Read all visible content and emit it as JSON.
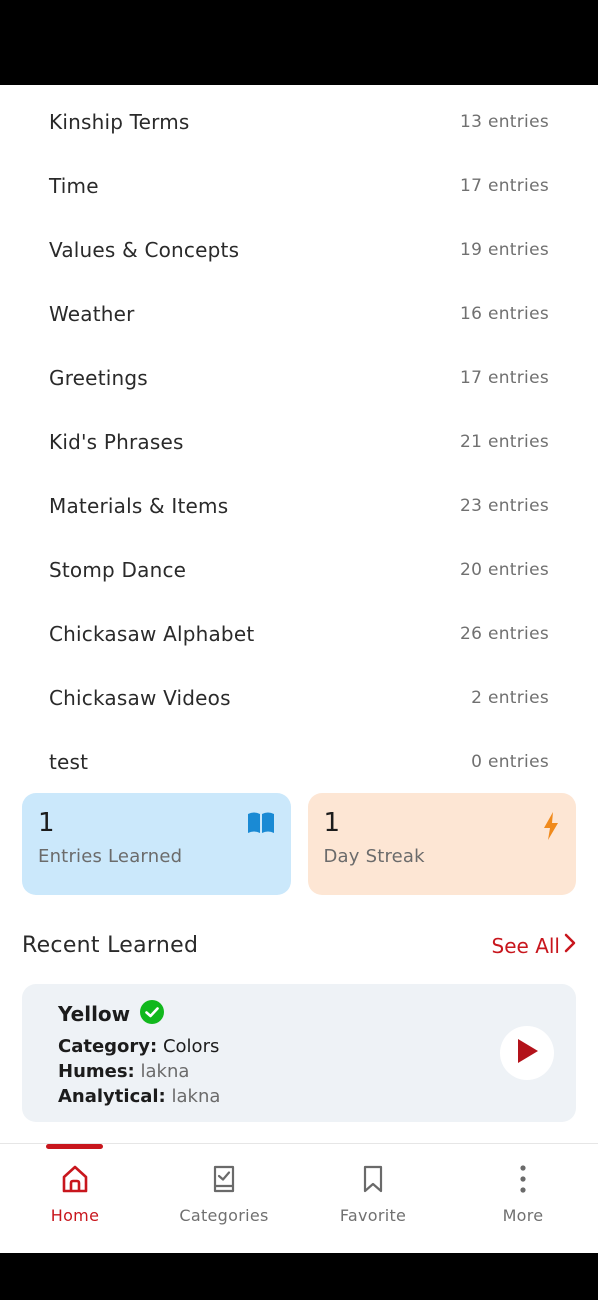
{
  "categories": [
    {
      "name": "Kinship Terms",
      "count": "13 entries"
    },
    {
      "name": "Time",
      "count": "17 entries"
    },
    {
      "name": "Values & Concepts",
      "count": "19 entries"
    },
    {
      "name": "Weather",
      "count": "16 entries"
    },
    {
      "name": "Greetings",
      "count": "17 entries"
    },
    {
      "name": "Kid's Phrases",
      "count": "21 entries"
    },
    {
      "name": "Materials & Items",
      "count": "23 entries"
    },
    {
      "name": "Stomp Dance",
      "count": "20 entries"
    },
    {
      "name": "Chickasaw Alphabet",
      "count": "26 entries"
    },
    {
      "name": "Chickasaw Videos",
      "count": "2 entries"
    },
    {
      "name": "test",
      "count": "0 entries"
    }
  ],
  "stats": {
    "learned": {
      "value": "1",
      "label": "Entries Learned",
      "icon": "book-icon"
    },
    "streak": {
      "value": "1",
      "label": "Day Streak",
      "icon": "lightning-icon"
    }
  },
  "recent": {
    "title": "Recent Learned",
    "see_all": "See All",
    "item": {
      "word": "Yellow",
      "category_key": "Category:",
      "category_value": "Colors",
      "humes_key": "Humes:",
      "humes_value": "lakna",
      "analytical_key": "Analytical:",
      "analytical_value": "lakna"
    }
  },
  "tabs": [
    {
      "label": "Home",
      "icon": "home-icon",
      "active": true
    },
    {
      "label": "Categories",
      "icon": "checklist-icon",
      "active": false
    },
    {
      "label": "Favorite",
      "icon": "bookmark-icon",
      "active": false
    },
    {
      "label": "More",
      "icon": "more-vertical-icon",
      "active": false
    }
  ],
  "colors": {
    "accent": "#c8161d",
    "learned_bg": "#cbe8fb",
    "streak_bg": "#fde6d4",
    "card_bg": "#eef2f6"
  }
}
